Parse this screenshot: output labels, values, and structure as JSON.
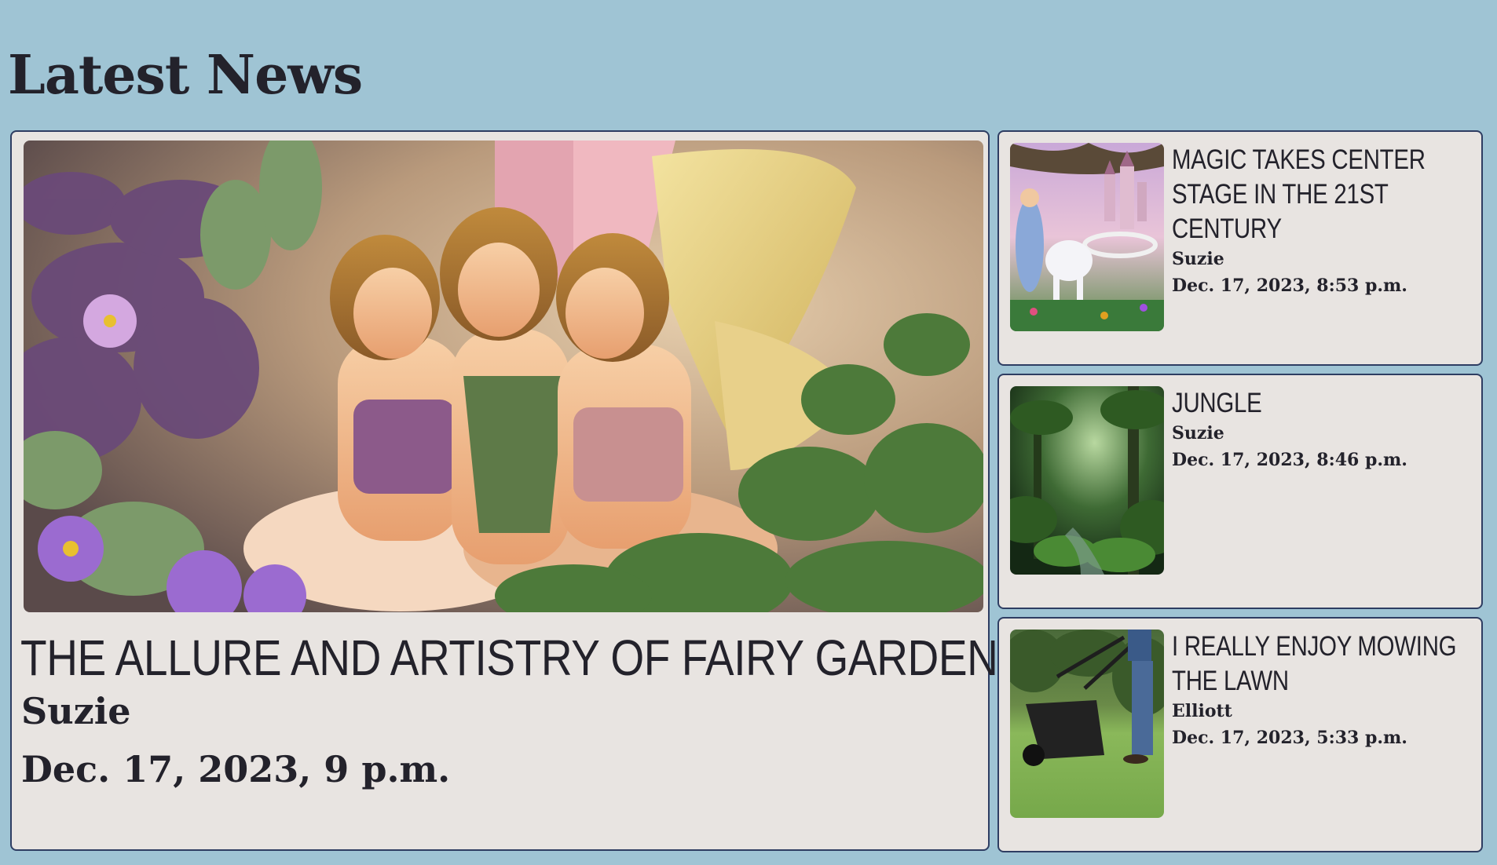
{
  "page": {
    "title": "Latest News"
  },
  "featured": {
    "headline": "THE ALLURE AND ARTISTRY OF FAIRY GARDENS",
    "author": "Suzie",
    "date": "Dec. 17, 2023, 9 p.m."
  },
  "articles": [
    {
      "headline": "MAGIC TAKES CENTER STAGE IN THE 21ST CENTURY",
      "author": "Suzie",
      "date": "Dec. 17, 2023, 8:53 p.m."
    },
    {
      "headline": "JUNGLE",
      "author": "Suzie",
      "date": "Dec. 17, 2023, 8:46 p.m."
    },
    {
      "headline": "I REALLY ENJOY MOWING THE LAWN",
      "author": "Elliott",
      "date": "Dec. 17, 2023, 5:33 p.m."
    }
  ],
  "colors": {
    "background": "#9fc4d4",
    "card": "#e8e4e1",
    "border": "#2e3d62",
    "text": "#23222b"
  }
}
